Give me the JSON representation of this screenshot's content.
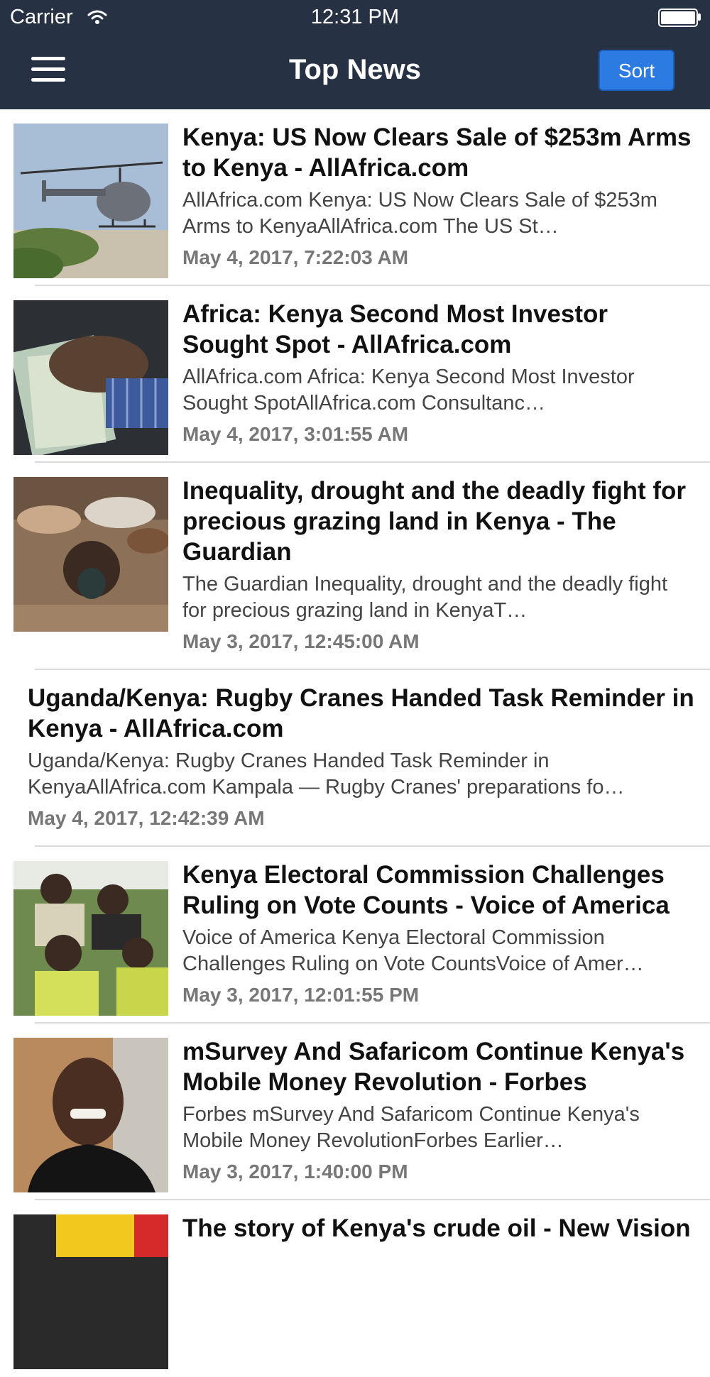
{
  "status_bar": {
    "carrier": "Carrier",
    "time": "12:31 PM"
  },
  "nav": {
    "title": "Top News",
    "sort_label": "Sort",
    "bar_color": "#263143",
    "accent": "#2c7be2"
  },
  "articles": [
    {
      "title": "Kenya: US Now Clears Sale of $253m Arms to Kenya - AllAfrica.com",
      "description": "AllAfrica.com    Kenya: US Now Clears Sale of $253m Arms to KenyaAllAfrica.com  The US St…",
      "date": "May 4, 2017, 7:22:03 AM",
      "thumbnail": "helicopter"
    },
    {
      "title": "Africa: Kenya Second Most Investor Sought Spot - AllAfrica.com",
      "description": "AllAfrica.com    Africa: Kenya Second Most Investor Sought SpotAllAfrica.com  Consultanc…",
      "date": "May 4, 2017, 3:01:55 AM",
      "thumbnail": "money"
    },
    {
      "title": "Inequality, drought and the deadly fight for precious grazing land in Kenya - The Guardian",
      "description": "The Guardian    Inequality, drought and the deadly fight for precious grazing land in KenyaT…",
      "date": "May 3, 2017, 12:45:00 AM",
      "thumbnail": "cattle"
    },
    {
      "title": "Uganda/Kenya: Rugby Cranes Handed Task Reminder in Kenya - AllAfrica.com",
      "description": "Uganda/Kenya: Rugby Cranes Handed Task Reminder in KenyaAllAfrica.com  Kampala — Rugby Cranes' preparations fo…",
      "date": "May 4, 2017, 12:42:39 AM",
      "thumbnail": ""
    },
    {
      "title": "Kenya Electoral Commission Challenges Ruling on Vote Counts - Voice of America",
      "description": "Voice of America    Kenya Electoral Commission Challenges Ruling on Vote CountsVoice of Amer…",
      "date": "May 3, 2017, 12:01:55 PM",
      "thumbnail": "crowd"
    },
    {
      "title": "mSurvey And Safaricom Continue Kenya's Mobile Money Revolution - Forbes",
      "description": "Forbes    mSurvey And Safaricom Continue Kenya's Mobile Money RevolutionForbes  Earlier…",
      "date": "May 3, 2017, 1:40:00 PM",
      "thumbnail": "portrait"
    },
    {
      "title": "The story of Kenya's crude oil - New Vision",
      "description": "",
      "date": "",
      "thumbnail": "oil"
    }
  ]
}
